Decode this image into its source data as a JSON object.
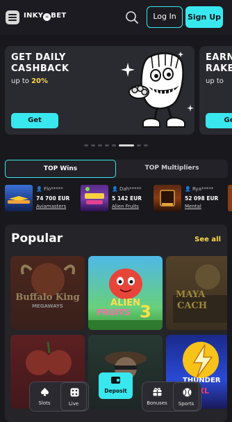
{
  "header": {
    "logo_text": "INKY",
    "logo_mid": "☠",
    "logo_suffix": "BET",
    "login_label": "Log In",
    "signup_label": "Sign Up"
  },
  "promos": [
    {
      "title_line1": "GET DAILY",
      "title_line2": "CASHBACK",
      "sub_prefix": "up to ",
      "sub_value": "20%",
      "button": "Get"
    },
    {
      "title_line1": "EARN",
      "title_line2": "RAKE",
      "sub_prefix": "up to ",
      "button": "Ge"
    }
  ],
  "carousel": {
    "count": 8,
    "active_index": 5
  },
  "tabs": {
    "top_wins": "TOP Wins",
    "top_multipliers": "TOP Multipliers"
  },
  "wins": [
    {
      "user": "Flo*****",
      "amount": "74 700 EUR",
      "game": "Aviamasters"
    },
    {
      "user": "Dah*****",
      "amount": "5 142 EUR",
      "game": "Alien Fruits"
    },
    {
      "user": "Rya*****",
      "amount": "52 098 EUR",
      "game": "Mental"
    }
  ],
  "popular": {
    "title": "Popular",
    "see_all": "See all",
    "games": [
      {
        "title": "Buffalo King",
        "subtitle": "MEGAWAYS"
      },
      {
        "title": "ALIEN",
        "subtitle": "FRUITS",
        "number": "3"
      },
      {
        "title": "MAYA",
        "subtitle": "CACH"
      },
      {
        "title": ""
      },
      {
        "title": ""
      },
      {
        "title": "THUNDER",
        "subtitle": "XXL"
      }
    ]
  },
  "bottom_nav": {
    "slots": "Slots",
    "live": "Live",
    "deposit": "Deposit",
    "bonuses": "Bonuses",
    "sports": "Sports"
  },
  "colors": {
    "accent": "#39e8ef",
    "highlight": "#ffd84a",
    "background": "#18181d",
    "card": "#2a2a31"
  }
}
